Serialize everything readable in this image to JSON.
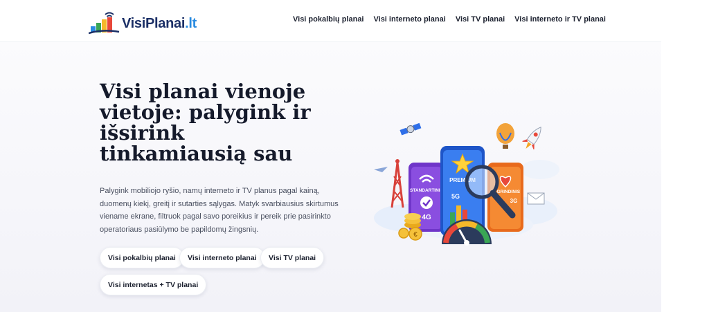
{
  "brand": {
    "name": "VisiPlanai",
    "tld": ".lt"
  },
  "nav": {
    "items": [
      {
        "label": "Visi pokalbių planai"
      },
      {
        "label": "Visi interneto planai"
      },
      {
        "label": "Visi TV planai"
      },
      {
        "label": "Visi interneto ir TV planai"
      }
    ]
  },
  "hero": {
    "title": "Visi planai vienoje vietoje: palygink ir išsirink tinkamiausią sau",
    "description": "Palygink mobiliojo ryšio, namų interneto ir TV planus pagal kainą, duomenų kiekį, greitį ir sutarties sąlygas. Matyk svarbiausius skirtumus viename ekrane, filtruok pagal savo poreikius ir pereik prie pasirinkto operatoriaus pasiūlymo be papildomų žingsnių.",
    "buttons": [
      {
        "label": "Visi pokalbių planai"
      },
      {
        "label": "Visi interneto planai"
      },
      {
        "label": "Visi TV planai"
      },
      {
        "label": "Visi internetas + TV planai"
      }
    ]
  },
  "illustration": {
    "phones": [
      {
        "label": "STANDARTINIS",
        "network": "4G",
        "color": "#7b3fd6"
      },
      {
        "label": "PREMIUM",
        "network": "5G",
        "color": "#2f6fe8"
      },
      {
        "label": "PAGRINDINIS",
        "network": "3G",
        "color": "#f07a22"
      }
    ],
    "coin_symbol": "€"
  },
  "colors": {
    "brand_dark": "#1b2f66",
    "brand_accent": "#2a8be0",
    "text": "#151a2b"
  }
}
